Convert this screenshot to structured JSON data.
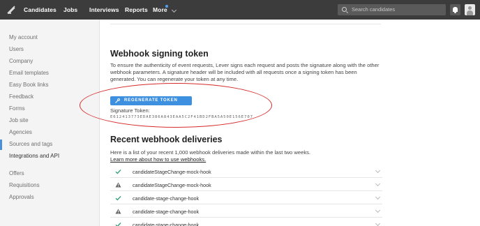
{
  "nav": {
    "logo_icon": "lever-logo-icon",
    "items": [
      "Candidates",
      "Jobs",
      "Interviews",
      "Reports",
      "More"
    ],
    "search_placeholder": "Search candidates",
    "accent": "#4fa3f7"
  },
  "sidebar": {
    "items": [
      "My account",
      "Users",
      "Company",
      "Email templates",
      "Easy Book links",
      "Feedback",
      "Forms",
      "Job site",
      "Agencies",
      "Sources and tags",
      "Integrations and API",
      "Offers",
      "Requisitions",
      "Approvals"
    ],
    "active": "Integrations and API"
  },
  "signing": {
    "title": "Webhook signing token",
    "description": "To ensure the authenticity of event requests, Lever signs each request and posts the signature along with the other webhook parameters. A signature header will be included with all requests once a signing token has been generated. You can regenerate your token at any time.",
    "button_label": "REGENERATE TOKEN",
    "token_label": "Signature Token:",
    "token_value": "E612413773EDAE386A843EAA5C2F41BD2FBA5A50E156E707",
    "highlight_color": "#d62b2b"
  },
  "deliveries": {
    "title": "Recent webhook deliveries",
    "description": "Here is a list of your recent 1,000 webhook deliveries made within the last two weeks.",
    "link_text": "Learn more about how to use webhooks.",
    "rows": [
      {
        "status": "success",
        "name": "candidateStageChange-mock-hook"
      },
      {
        "status": "warning",
        "name": "candidateStageChange-mock-hook"
      },
      {
        "status": "success",
        "name": "candidate-stage-change-hook"
      },
      {
        "status": "warning",
        "name": "candidate-stage-change-hook"
      },
      {
        "status": "success",
        "name": "candidate-stage-change-hook"
      }
    ]
  }
}
